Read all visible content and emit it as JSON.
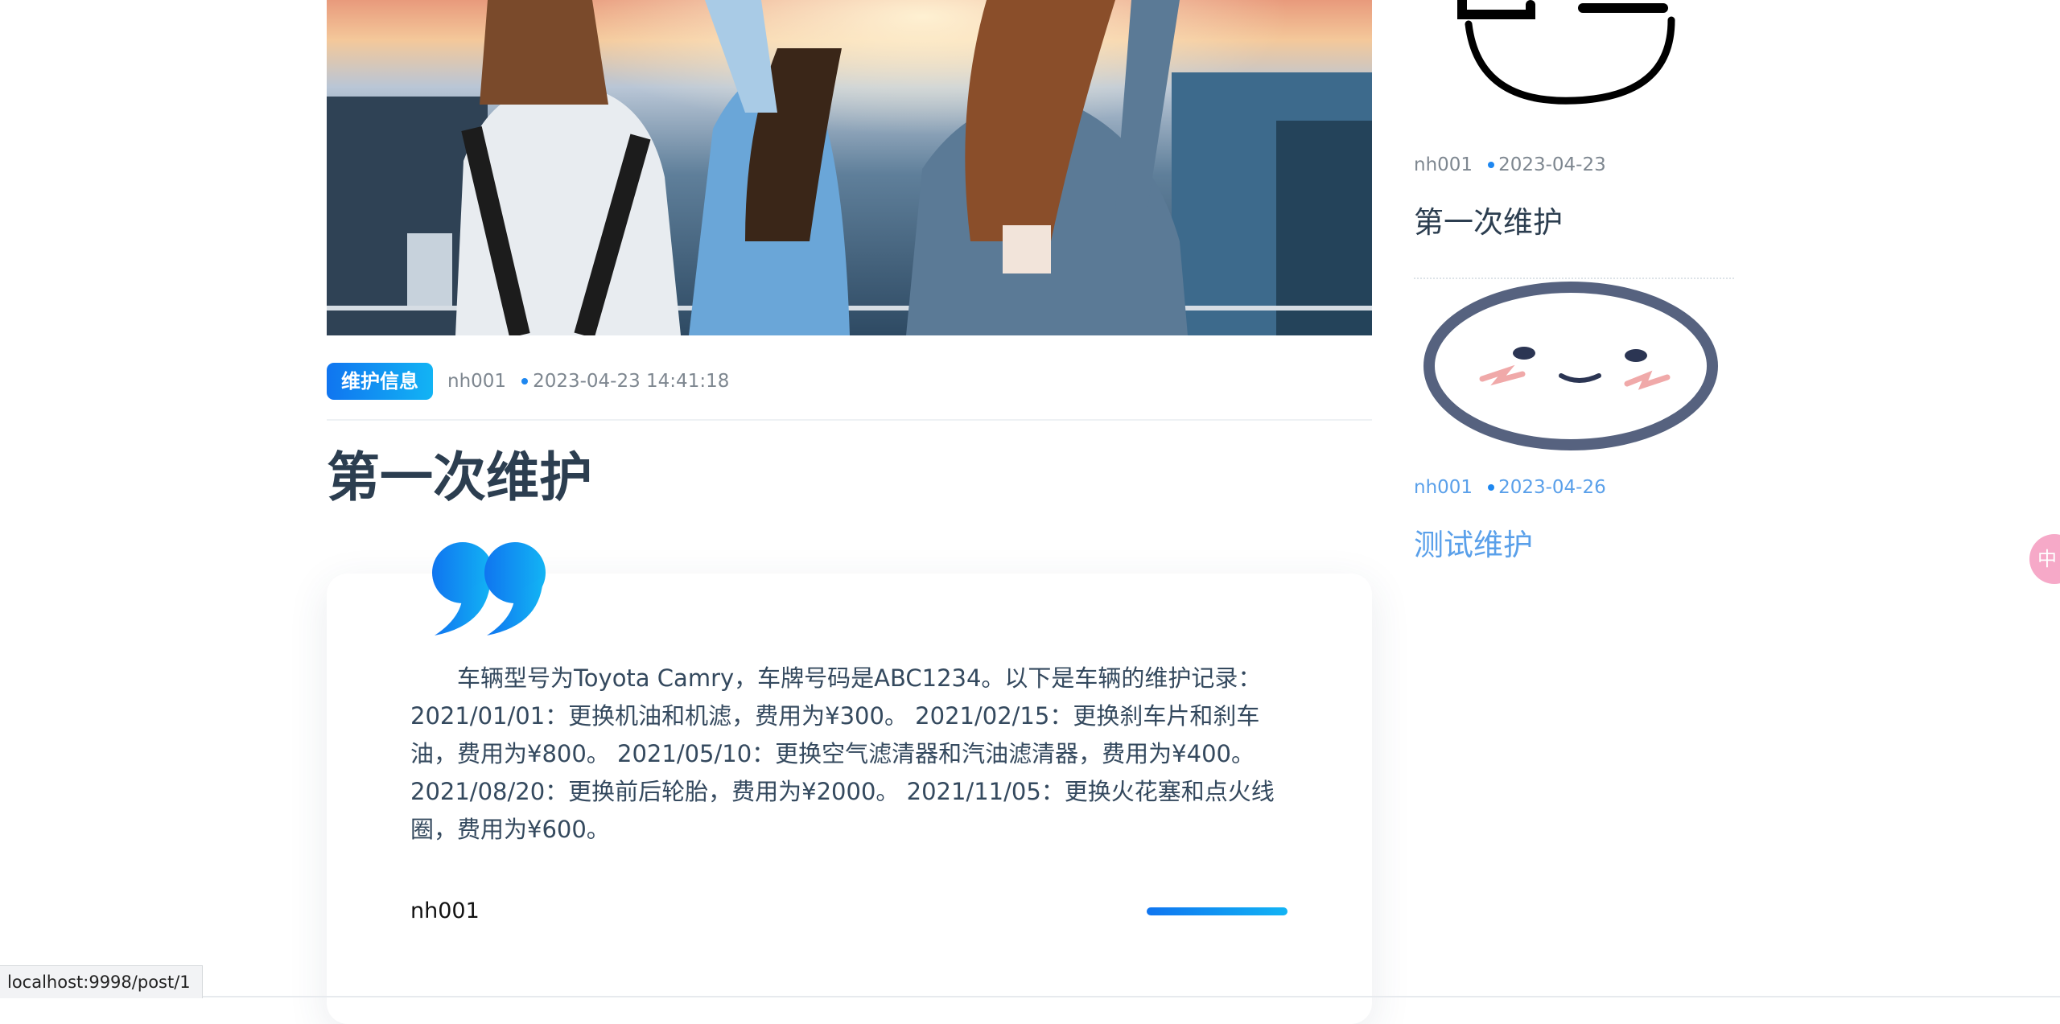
{
  "post": {
    "category": "维护信息",
    "author": "nh001",
    "datetime": "2023-04-23 14:41:18",
    "title": "第一次维护",
    "content": "车辆型号为Toyota Camry，车牌号码是ABC1234。以下是车辆的维护记录： 2021/01/01：更换机油和机滤，费用为¥300。 2021/02/15：更换刹车片和刹车油，费用为¥800。 2021/05/10：更换空气滤清器和汽油滤清器，费用为¥400。 2021/08/20：更换前后轮胎，费用为¥2000。 2021/11/05：更换火花塞和点火线圈，费用为¥600。",
    "quote_author": "nh001"
  },
  "sidebar": {
    "posts": [
      {
        "author": "nh001",
        "date": "2023-04-23",
        "title": "第一次维护"
      },
      {
        "author": "nh001",
        "date": "2023-04-26",
        "title": "测试维护"
      }
    ]
  },
  "status_bar": {
    "url": "localhost:9998/post/1"
  },
  "floating_button": {
    "label": "中"
  },
  "colors": {
    "accent": "#1075f0",
    "accent_light": "#12b4f4",
    "link_hover": "#5aa0ea",
    "title": "#2c3e50"
  }
}
